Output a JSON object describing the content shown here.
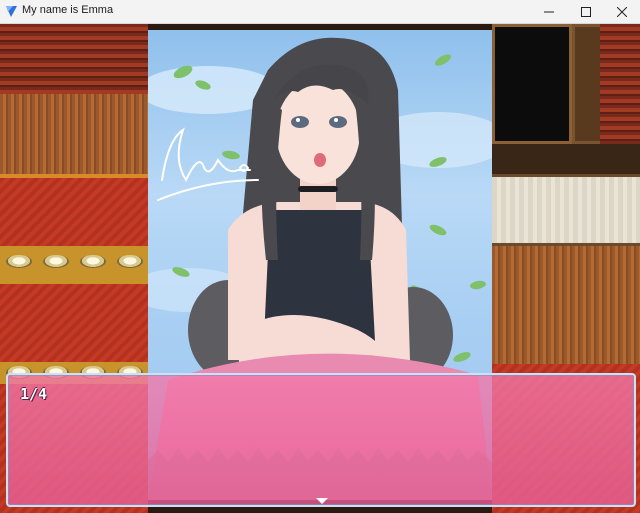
{
  "window": {
    "title": "My name is Emma",
    "controls": {
      "minimize_icon": "minimize-icon",
      "maximize_icon": "maximize-icon",
      "close_icon": "close-icon"
    }
  },
  "message": {
    "text": "1/4",
    "continue_indicator": "down-arrow-icon"
  },
  "colors": {
    "message_window": "#e8609a",
    "message_border": "#cfe0f5",
    "sky": "#a9cff3",
    "hair": "#4a4a4e",
    "top": "#2e3340",
    "skin": "#f6dcd4"
  }
}
